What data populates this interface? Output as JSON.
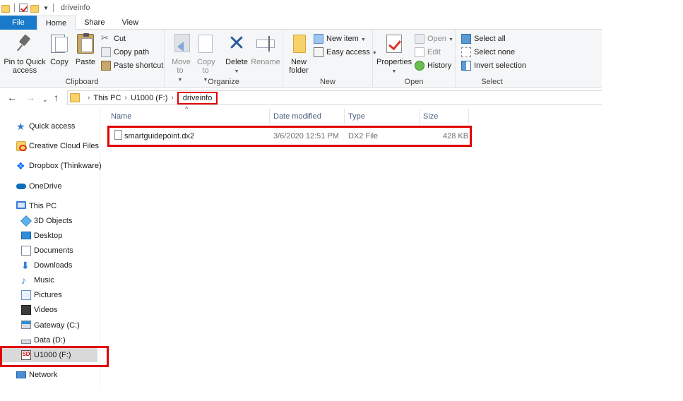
{
  "window": {
    "title": "driveinfo"
  },
  "tabs": [
    {
      "label": "File"
    },
    {
      "label": "Home"
    },
    {
      "label": "Share"
    },
    {
      "label": "View"
    }
  ],
  "ribbon": {
    "clipboard": {
      "label": "Clipboard",
      "pin": "Pin to Quick access",
      "copy": "Copy",
      "paste": "Paste",
      "cut": "Cut",
      "copy_path": "Copy path",
      "paste_shortcut": "Paste shortcut"
    },
    "organize": {
      "label": "Organize",
      "move_to": "Move to",
      "copy_to": "Copy to",
      "delete": "Delete",
      "rename": "Rename"
    },
    "new": {
      "label": "New",
      "new_folder": "New folder",
      "new_item": "New item",
      "easy_access": "Easy access"
    },
    "open": {
      "label": "Open",
      "properties": "Properties",
      "open": "Open",
      "edit": "Edit",
      "history": "History"
    },
    "select": {
      "label": "Select",
      "select_all": "Select all",
      "select_none": "Select none",
      "invert_selection": "Invert selection"
    }
  },
  "address": {
    "crumbs": [
      "This PC",
      "U1000 (F:)",
      "driveinfo"
    ]
  },
  "sidebar": {
    "items": [
      {
        "label": "Quick access",
        "icon": "star-icon"
      },
      {
        "label": "Creative Cloud Files",
        "icon": "creative-cloud-icon"
      },
      {
        "label": "Dropbox (Thinkware)",
        "icon": "dropbox-icon"
      },
      {
        "label": "OneDrive",
        "icon": "cloud-icon"
      },
      {
        "label": "This PC",
        "icon": "computer-icon"
      },
      {
        "label": "3D Objects",
        "icon": "cube-icon"
      },
      {
        "label": "Desktop",
        "icon": "desktop-icon"
      },
      {
        "label": "Documents",
        "icon": "documents-icon"
      },
      {
        "label": "Downloads",
        "icon": "download-icon"
      },
      {
        "label": "Music",
        "icon": "music-icon"
      },
      {
        "label": "Pictures",
        "icon": "pictures-icon"
      },
      {
        "label": "Videos",
        "icon": "videos-icon"
      },
      {
        "label": "Gateway (C:)",
        "icon": "system-drive-icon"
      },
      {
        "label": "Data (D:)",
        "icon": "drive-icon"
      },
      {
        "label": "U1000 (F:)",
        "icon": "sd-card-icon"
      },
      {
        "label": "Network",
        "icon": "network-icon"
      }
    ]
  },
  "filelist": {
    "columns": {
      "name": "Name",
      "date": "Date modified",
      "type": "Type",
      "size": "Size"
    },
    "rows": [
      {
        "name": "smartguidepoint.dx2",
        "date": "3/6/2020 12:51 PM",
        "type": "DX2 File",
        "size": "428 KB"
      }
    ]
  },
  "colors": {
    "accent": "#1979ca",
    "highlight": "#e00000",
    "selection": "#d9d9d9"
  }
}
